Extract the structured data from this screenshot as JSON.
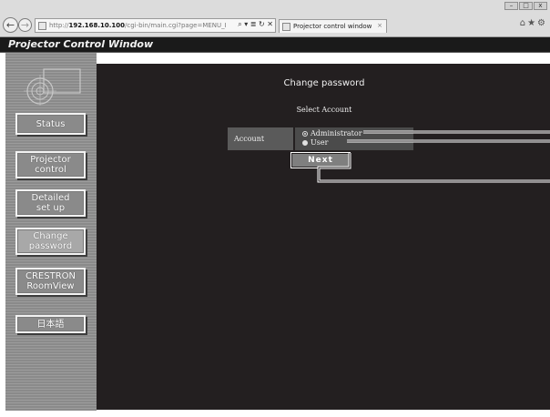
{
  "browser": {
    "address": {
      "prefix": "http://",
      "host": "192.168.10.100",
      "path": "/cgi-bin/main.cgi?page=MENU_I",
      "tools": "⌕ ▾ ≣ ↻ ✕"
    },
    "tab": {
      "label": "Projector control window",
      "close": "×"
    },
    "toolbar_icons": "⌂★⚙",
    "window_controls": [
      "–",
      "□",
      "x"
    ],
    "nav": {
      "back": "←",
      "forward": "→"
    }
  },
  "page": {
    "title": "Projector Control Window"
  },
  "sidebar": {
    "buttons": [
      {
        "label": "Status"
      },
      {
        "label": "Projector\ncontrol"
      },
      {
        "label": "Detailed\nset up"
      },
      {
        "label": "Change\npassword"
      },
      {
        "label": "CRESTRON\nRoomView"
      },
      {
        "label": "日本語"
      }
    ]
  },
  "main": {
    "title": "Change password",
    "subtitle": "Select Account",
    "account_label": "Account",
    "options": [
      {
        "label": "Administrator",
        "selected": true
      },
      {
        "label": "User",
        "selected": false
      }
    ],
    "next_button": "Next"
  },
  "colors": {
    "panel_bg": "#231f20",
    "title_bar_bg": "#1a1a1a",
    "sidebar_bg": "#8a8a8a"
  }
}
